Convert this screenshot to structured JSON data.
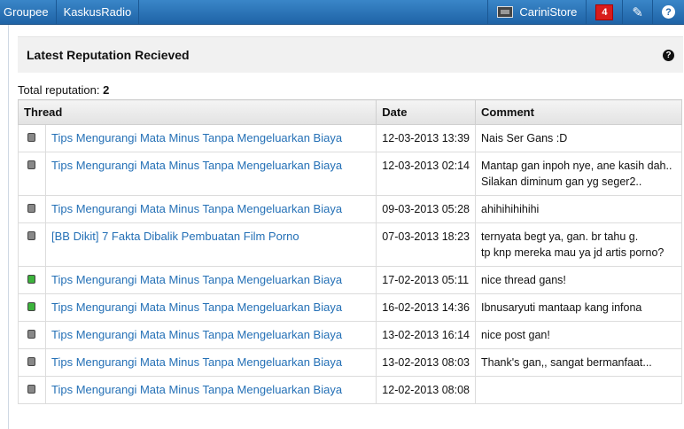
{
  "topbar": {
    "left_items": [
      "Groupee",
      "KaskusRadio"
    ],
    "store_label": "CariniStore",
    "notification_count": "4",
    "help_label": "?"
  },
  "panel": {
    "title": "Latest Reputation Recieved",
    "help_label": "?"
  },
  "total": {
    "label": "Total reputation:",
    "value": "2"
  },
  "table": {
    "headers": [
      "Thread",
      "Date",
      "Comment"
    ],
    "rows": [
      {
        "status": "neutral",
        "color": "#888888",
        "thread": "Tips Mengurangi Mata Minus Tanpa Mengeluarkan Biaya",
        "date": "12-03-2013 13:39",
        "comment": [
          "Nais Ser Gans :D"
        ]
      },
      {
        "status": "neutral",
        "color": "#888888",
        "thread": "Tips Mengurangi Mata Minus Tanpa Mengeluarkan Biaya",
        "date": "12-03-2013 02:14",
        "comment": [
          "Mantap gan inpoh nye, ane kasih dah..",
          "Silakan diminum gan yg seger2.."
        ]
      },
      {
        "status": "neutral",
        "color": "#888888",
        "thread": "Tips Mengurangi Mata Minus Tanpa Mengeluarkan Biaya",
        "date": "09-03-2013 05:28",
        "comment": [
          "ahihihihihihi"
        ]
      },
      {
        "status": "neutral",
        "color": "#888888",
        "thread": "[BB Dikit] 7 Fakta Dibalik Pembuatan Film Porno",
        "date": "07-03-2013 18:23",
        "comment": [
          "ternyata begt ya, gan. br tahu g.",
          "tp knp mereka mau ya jd artis porno?"
        ]
      },
      {
        "status": "positive",
        "color": "#3cb33c",
        "thread": "Tips Mengurangi Mata Minus Tanpa Mengeluarkan Biaya",
        "date": "17-02-2013 05:11",
        "comment": [
          "nice thread gans!"
        ]
      },
      {
        "status": "positive",
        "color": "#3cb33c",
        "thread": "Tips Mengurangi Mata Minus Tanpa Mengeluarkan Biaya",
        "date": "16-02-2013 14:36",
        "comment": [
          "Ibnusaryuti mantaap kang infona"
        ]
      },
      {
        "status": "neutral",
        "color": "#888888",
        "thread": "Tips Mengurangi Mata Minus Tanpa Mengeluarkan Biaya",
        "date": "13-02-2013 16:14",
        "comment": [
          "nice post gan!"
        ]
      },
      {
        "status": "neutral",
        "color": "#888888",
        "thread": "Tips Mengurangi Mata Minus Tanpa Mengeluarkan Biaya",
        "date": "13-02-2013 08:03",
        "comment": [
          "Thank's gan,, sangat bermanfaat..."
        ]
      },
      {
        "status": "neutral",
        "color": "#888888",
        "thread": "Tips Mengurangi Mata Minus Tanpa Mengeluarkan Biaya",
        "date": "12-02-2013 08:08",
        "comment": [
          ""
        ]
      }
    ]
  }
}
